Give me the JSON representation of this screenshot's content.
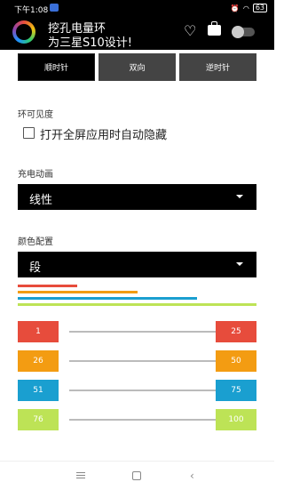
{
  "status": {
    "time": "下午1:08",
    "battery": "63"
  },
  "app": {
    "title_line1": "挖孔电量环",
    "title_line2": "为三星S10设计!"
  },
  "direction": {
    "buttons": [
      "顺时针",
      "双向",
      "逆时针"
    ],
    "selected": "顺时针"
  },
  "visibility": {
    "section_label": "环可见度",
    "fullscreen_hide_label": "打开全屏应用时自动隐藏",
    "fullscreen_hide_checked": false
  },
  "charge_anim": {
    "section_label": "充电动画",
    "value": "线性"
  },
  "color_config": {
    "section_label": "颜色配置",
    "value": "段",
    "preview_bars": [
      {
        "color": "#e74c3c",
        "fraction": 0.25
      },
      {
        "color": "#f39c12",
        "fraction": 0.5
      },
      {
        "color": "#1a9fd0",
        "fraction": 0.75
      },
      {
        "color": "#bde356",
        "fraction": 1.0
      }
    ],
    "ranges": [
      {
        "start": "1",
        "end": "25",
        "color": "#e74c3c"
      },
      {
        "start": "26",
        "end": "50",
        "color": "#f39c12"
      },
      {
        "start": "51",
        "end": "75",
        "color": "#1a9fd0"
      },
      {
        "start": "76",
        "end": "100",
        "color": "#bde356"
      }
    ]
  }
}
